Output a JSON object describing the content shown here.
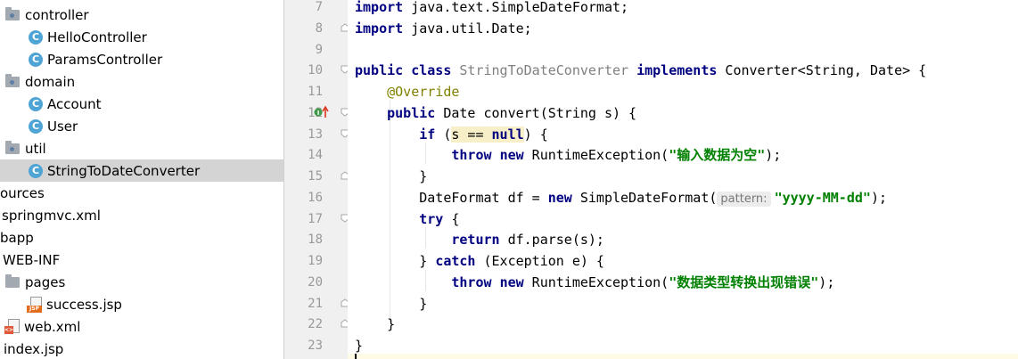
{
  "tree": {
    "items": [
      {
        "label": "controller",
        "type": "folder"
      },
      {
        "label": "HelloController",
        "type": "class"
      },
      {
        "label": "ParamsController",
        "type": "class"
      },
      {
        "label": "domain",
        "type": "folder"
      },
      {
        "label": "Account",
        "type": "class"
      },
      {
        "label": "User",
        "type": "class"
      },
      {
        "label": "util",
        "type": "folder"
      },
      {
        "label": "StringToDateConverter",
        "type": "class",
        "selected": true
      },
      {
        "label": "ources",
        "type": "folder-partial"
      },
      {
        "label": "springmvc.xml",
        "type": "xml"
      },
      {
        "label": "bapp",
        "type": "folder-partial"
      },
      {
        "label": "WEB-INF",
        "type": "folder-partial"
      },
      {
        "label": "pages",
        "type": "folder"
      },
      {
        "label": "success.jsp",
        "type": "jsp"
      },
      {
        "label": "web.xml",
        "type": "xml"
      },
      {
        "label": "index.jsp",
        "type": "jsp-partial"
      }
    ],
    "class_icon_letter": "C",
    "jsp_icon_text": "JSP"
  },
  "editor": {
    "line_numbers": [
      "7",
      "8",
      "9",
      "10",
      "11",
      "12",
      "13",
      "14",
      "15",
      "16",
      "17",
      "18",
      "19",
      "20",
      "21",
      "22",
      "23"
    ],
    "lines": {
      "l7_kw": "import",
      "l7_rest": " java.text.SimpleDateFormat;",
      "l8_kw": "import",
      "l8_rest": " java.util.Date;",
      "l10_kw1": "public",
      "l10_kw2": "class",
      "l10_cls": "StringToDateConverter",
      "l10_kw3": "implements",
      "l10_rest": " Converter<String, Date> {",
      "l11_ann": "@Override",
      "l12_kw": "public",
      "l12_rest": " Date convert(String s) {",
      "l13_kw": "if",
      "l13_pre": " (",
      "l13_hl": "s == ",
      "l13_kw2": "null",
      "l13_post": ") {",
      "l14_kw1": "throw",
      "l14_kw2": "new",
      "l14_mid": " RuntimeException(",
      "l14_str": "\"输入数据为空\"",
      "l14_post": ");",
      "l15": "}",
      "l16_pre": "DateFormat df = ",
      "l16_kw": "new",
      "l16_mid": " SimpleDateFormat(",
      "l16_hint": "pattern:",
      "l16_str": "\"yyyy-MM-dd\"",
      "l16_post": ");",
      "l17_kw": "try",
      "l17_rest": " {",
      "l18_kw": "return",
      "l18_rest": " df.parse(s);",
      "l19_pre": "} ",
      "l19_kw": "catch",
      "l19_rest": " (Exception e) {",
      "l20_kw1": "throw",
      "l20_kw2": "new",
      "l20_mid": " RuntimeException(",
      "l20_str": "\"数据类型转换出现错误\"",
      "l20_post": ");",
      "l21": "}",
      "l22": "}",
      "l23": "}"
    }
  },
  "colors": {
    "keyword": "#000080",
    "string": "#008000",
    "annotation": "#808000",
    "class_name": "#808080",
    "selection": "#d4d4d4",
    "gutter": "#f0f0f0"
  }
}
